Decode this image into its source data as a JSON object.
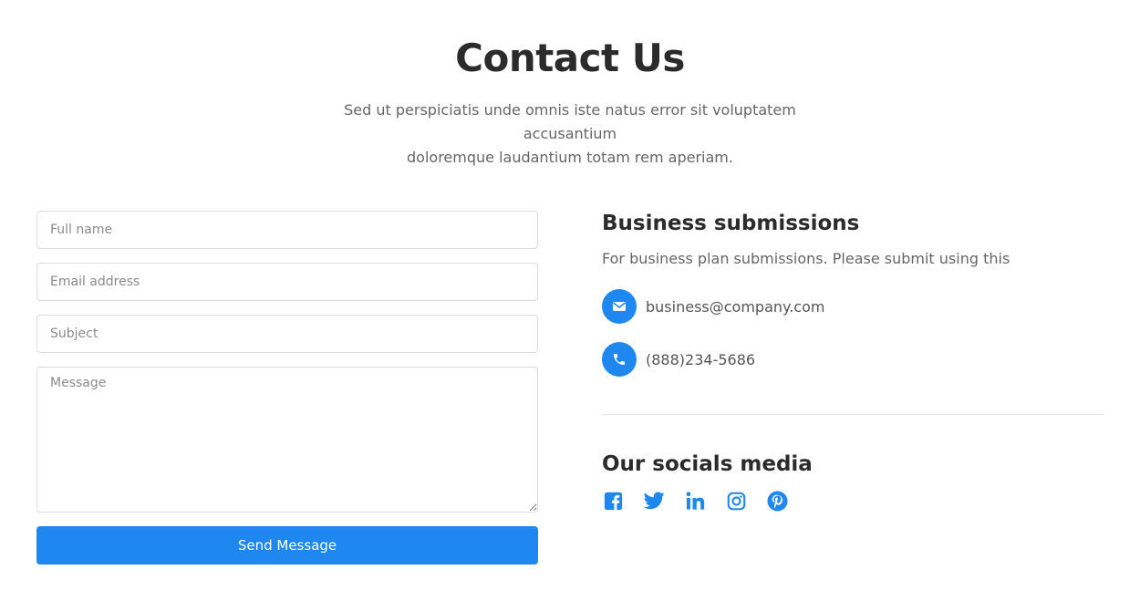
{
  "header": {
    "title": "Contact Us",
    "subtitle_line1": "Sed ut perspiciatis unde omnis iste natus error sit voluptatem accusantium",
    "subtitle_line2": "doloremque laudantium totam rem aperiam."
  },
  "form": {
    "full_name_placeholder": "Full name",
    "email_placeholder": "Email address",
    "subject_placeholder": "Subject",
    "message_placeholder": "Message",
    "full_name_value": "",
    "email_value": "",
    "subject_value": "",
    "message_value": "",
    "submit_label": "Send Message"
  },
  "business": {
    "title": "Business submissions",
    "description": "For business plan submissions. Please submit using this",
    "email": "business@company.com",
    "phone": "(888)234-5686",
    "email_icon": "envelope-icon",
    "phone_icon": "phone-icon"
  },
  "socials": {
    "title": "Our socials media",
    "icons": [
      "facebook-icon",
      "twitter-icon",
      "linkedin-icon",
      "instagram-icon",
      "pinterest-icon"
    ]
  },
  "colors": {
    "accent": "#1e87f0",
    "heading": "#2b2b2b",
    "muted_text": "#666666",
    "border": "#dcdcdc"
  }
}
